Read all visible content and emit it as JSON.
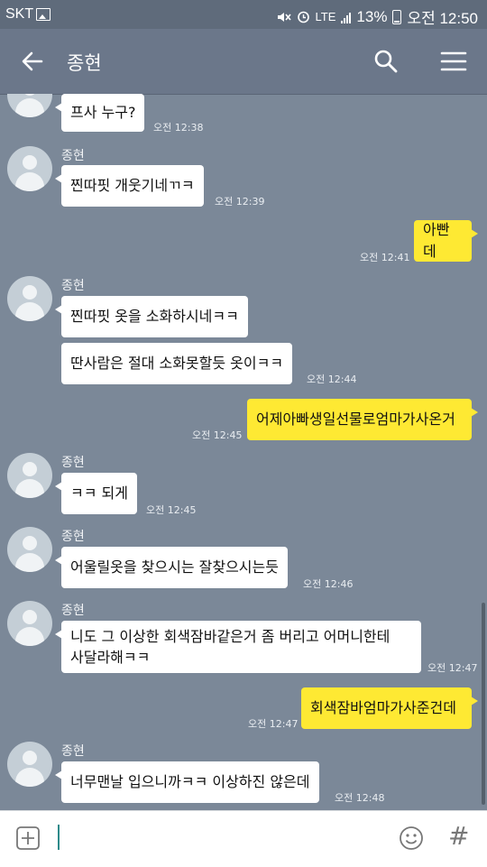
{
  "status_bar": {
    "carrier": "SKT",
    "network": "LTE",
    "battery": "13%",
    "time": "오전 12:50"
  },
  "header": {
    "title": "종현",
    "icons": [
      "back-arrow-icon",
      "search-icon",
      "menu-icon"
    ]
  },
  "chat": {
    "messages": [
      {
        "sender": "",
        "text": "프사 누구?",
        "time": "오전 12:38"
      },
      {
        "sender": "종현",
        "text": "찐따핏 개웃기네ㄲㅋ",
        "time": "오전 12:39"
      },
      {
        "sender": "",
        "text": "아빤데",
        "time": "오전 12:41"
      },
      {
        "sender": "종현",
        "text": "찐따핏 옷을 소화하시네ㅋㅋ",
        "time": ""
      },
      {
        "sender": "",
        "text": "딴사람은 절대 소화못할듯 옷이ㅋㅋ",
        "time": "오전 12:44"
      },
      {
        "sender": "",
        "text": "어제아빠생일선물로엄마가사온거",
        "time": "오전 12:45"
      },
      {
        "sender": "종현",
        "text": "ㅋㅋ 되게",
        "time": "오전 12:45"
      },
      {
        "sender": "종현",
        "text": "어울릴옷을 찾으시는 잘찾으시는듯",
        "time": "오전 12:46"
      },
      {
        "sender": "종현",
        "text": "니도 그 이상한 회색잠바같은거 좀 버리고 어머니한테",
        "text2": "사달라해ㅋㅋ",
        "time": "오전 12:47"
      },
      {
        "sender": "",
        "text": "회색잠바엄마가사준건데",
        "time": "오전 12:47"
      },
      {
        "sender": "종현",
        "text": "너무맨날 입으니까ㅋㅋ 이상하진 않은데",
        "time": "오전 12:48"
      }
    ]
  },
  "input_bar": {
    "message_value": "",
    "icons": [
      "add-icon",
      "emoji-icon",
      "hashtag-icon"
    ],
    "hash_symbol": "#"
  },
  "colors": {
    "chat_background": "#7b8898",
    "my_bubble": "#fee933",
    "their_bubble": "#ffffff",
    "header": "#6b778a"
  }
}
